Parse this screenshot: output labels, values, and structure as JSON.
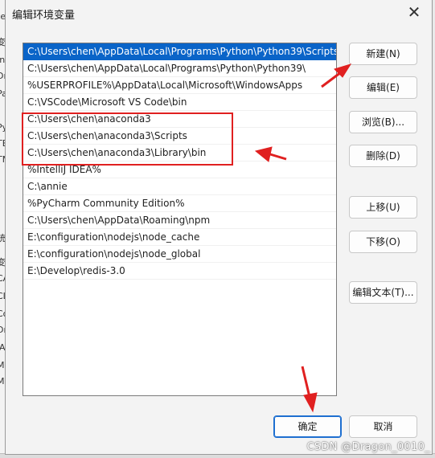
{
  "dialog": {
    "title": "编辑环境变量",
    "close_glyph": "✕"
  },
  "background_fragments": [
    "ter",
    "变",
    "In",
    "Dr",
    "Pa",
    "Py",
    "TE",
    "TM",
    "统",
    "变",
    "CA",
    "CL",
    "Co",
    "Dr",
    "JA",
    "M",
    "M"
  ],
  "path_list": {
    "selected_index": 0,
    "items": [
      "C:\\Users\\chen\\AppData\\Local\\Programs\\Python\\Python39\\Scripts\\",
      "C:\\Users\\chen\\AppData\\Local\\Programs\\Python\\Python39\\",
      "%USERPROFILE%\\AppData\\Local\\Microsoft\\WindowsApps",
      "C:\\VSCode\\Microsoft VS Code\\bin",
      "C:\\Users\\chen\\anaconda3",
      "C:\\Users\\chen\\anaconda3\\Scripts",
      "C:\\Users\\chen\\anaconda3\\Library\\bin",
      "%IntelliJ IDEA%",
      "C:\\annie",
      "%PyCharm Community Edition%",
      "C:\\Users\\chen\\AppData\\Roaming\\npm",
      "E:\\configuration\\nodejs\\node_cache",
      "E:\\configuration\\nodejs\\node_global",
      "E:\\Develop\\redis-3.0"
    ]
  },
  "buttons": {
    "new": "新建(N)",
    "edit": "编辑(E)",
    "browse": "浏览(B)...",
    "delete": "删除(D)",
    "move_up": "上移(U)",
    "move_down": "下移(O)",
    "edit_text": "编辑文本(T)...",
    "ok": "确定",
    "cancel": "取消"
  },
  "annotations": {
    "color": "#e02020"
  },
  "watermark": "CSDN @Dragon_0010_"
}
